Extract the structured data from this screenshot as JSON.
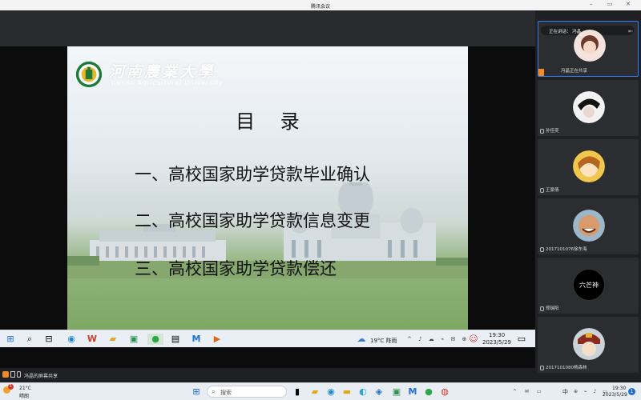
{
  "window": {
    "title": "腾讯会议"
  },
  "slide": {
    "uni_name_cn": "河南農業大學",
    "uni_name_en": "Henan Agricultural University",
    "title": "目 录",
    "items": [
      "一、高校国家助学贷款毕业确认",
      "二、高校国家助学贷款信息变更",
      "三、高校国家助学贷款偿还"
    ]
  },
  "presenter_taskbar": {
    "weather": "19°C 阵雨",
    "time": "19:30",
    "date": "2023/5/29"
  },
  "share_status": "冯晶的屏幕共享",
  "participants": [
    {
      "name": "冯晶正在共享",
      "speaking_label": "正在讲话： 冯晶",
      "active": true
    },
    {
      "name": "孙佳奕"
    },
    {
      "name": "王豪倩"
    },
    {
      "name": "2017101076徐东海"
    },
    {
      "name": "郑瑞阳",
      "avatar_text": "六芒神"
    },
    {
      "name": "2017101080杨森林"
    }
  ],
  "windows_taskbar": {
    "weather_temp": "21°C",
    "weather_desc": "晴朗",
    "search_placeholder": "搜索",
    "ime": "中",
    "time": "19:30",
    "date": "2023/5/29",
    "notification_count": "1"
  },
  "colors": {
    "accent": "#2f7dff",
    "panel_bg": "#1f2023",
    "tile_bg": "#2c2d30"
  }
}
